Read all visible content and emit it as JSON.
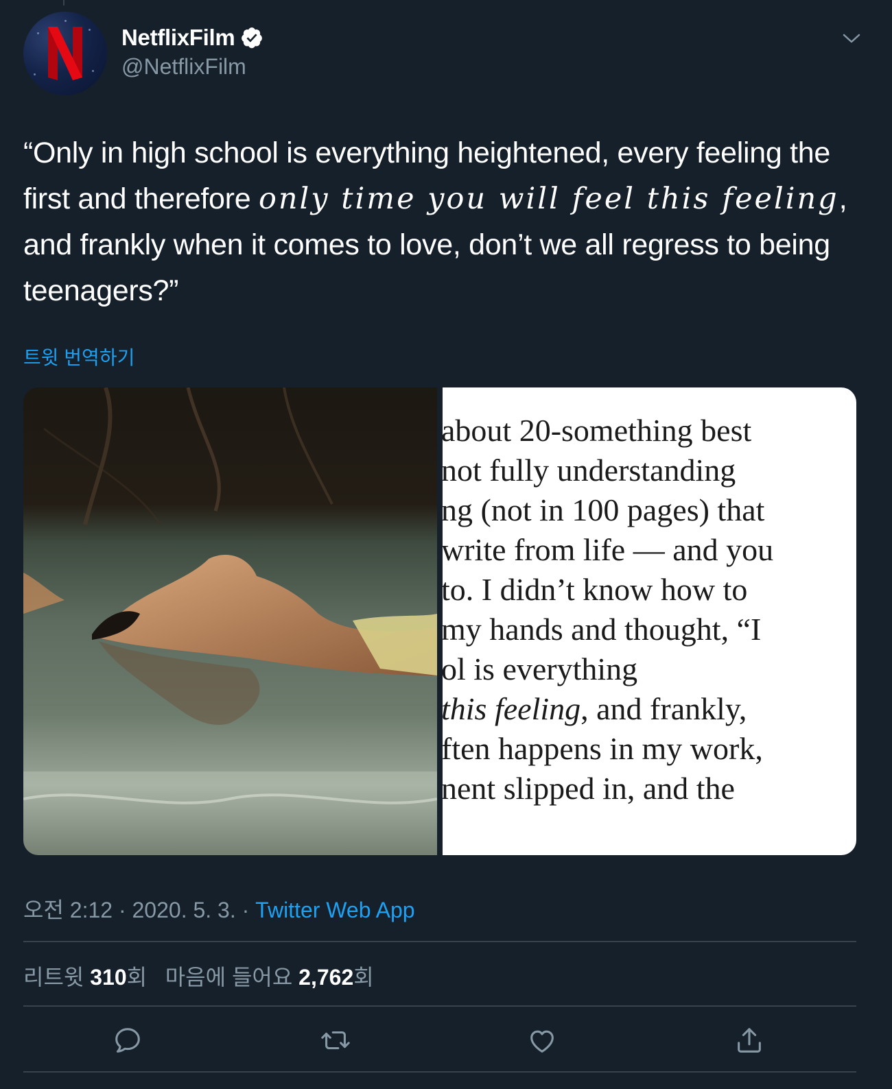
{
  "author": {
    "display_name": "NetflixFilm",
    "handle": "@NetflixFilm",
    "verified": true,
    "avatar_letter": "N"
  },
  "tweet": {
    "text_part1": "“Only in high school is everything heightened, every feeling the first and therefore ",
    "text_fancy": "only time you will feel this feeling",
    "text_part2": ", and frankly when it comes to love, don’t we all regress to being teenagers?”",
    "translate_label": "트윗 번역하기"
  },
  "media": {
    "book_lines": [
      "about 20-something best",
      "not fully understanding",
      "ng (not in 100 pages) that",
      "write from life — and you",
      "to. I didn’t know how to",
      "my hands and thought, “I",
      "ol is everything",
      "this feeling, and frankly,",
      "ften happens in my work,",
      "nent slipped in, and the"
    ]
  },
  "meta": {
    "time": "오전 2:12",
    "separator": " · ",
    "date": "2020. 5. 3.",
    "source": "Twitter Web App"
  },
  "stats": {
    "retweets_label": "리트윗 ",
    "retweets_count": "310",
    "retweets_suffix": "회",
    "likes_label": "마음에 들어요 ",
    "likes_count": "2,762",
    "likes_suffix": "회"
  },
  "actions": [
    "reply-icon",
    "retweet-icon",
    "like-icon",
    "share-icon"
  ],
  "colors": {
    "background": "#15202b",
    "accent": "#1da1f2",
    "secondary_text": "#8899a6",
    "divider": "#38444d",
    "netflix_red": "#e50914"
  }
}
